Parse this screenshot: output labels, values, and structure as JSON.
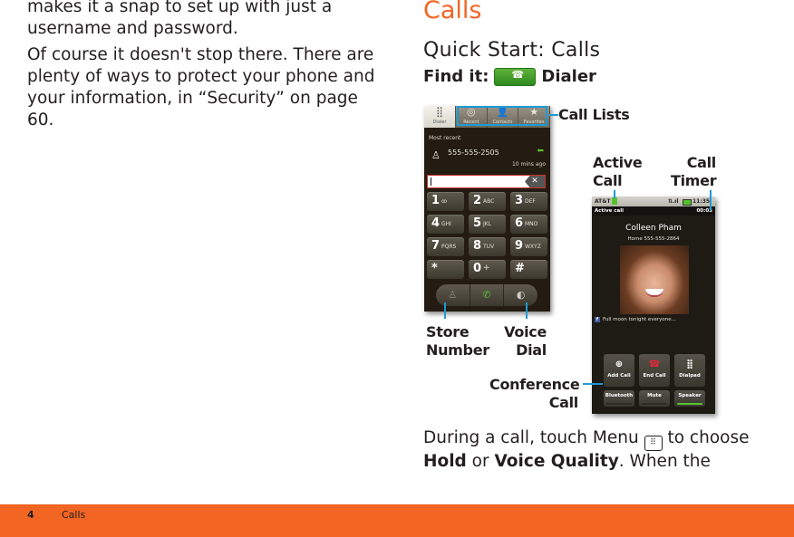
{
  "left_column": {
    "paragraph_1": "makes it a snap to set up with just a username and password.",
    "paragraph_2": "Of course it doesn't stop there. There are plenty of ways to protect your phone and your information, in “Security” on page 60."
  },
  "right_column": {
    "chapter_title": "Calls",
    "section_title": "Quick Start: Calls",
    "find_it_label": "Find it:",
    "find_it_target": "Dialer",
    "find_it_icon": "phone-handset-icon",
    "body": {
      "sentence_start": "During a call, touch Menu",
      "menu_icon": "menu-key-icon",
      "sentence_mid": "to choose",
      "option_1": "Hold",
      "connector": "or",
      "option_2": "Voice Quality",
      "sentence_end": ". When the"
    }
  },
  "dialer_screen": {
    "tabs": [
      {
        "label": "Dialer",
        "icon": "keypad-grid-icon",
        "active": true
      },
      {
        "label": "Recent",
        "icon": "recent-calls-icon",
        "active": false
      },
      {
        "label": "Contacts",
        "icon": "contact-icon",
        "active": false
      },
      {
        "label": "Favorites",
        "icon": "star-icon",
        "active": false
      }
    ],
    "section_label": "Most recent",
    "recent_call": {
      "number": "555-555-2505",
      "time": "10 mins ago",
      "direction_icon": "incoming-arrow-icon"
    },
    "input_value": "",
    "keys": [
      {
        "digit": "1",
        "letters": "ꝏ"
      },
      {
        "digit": "2",
        "letters": "ABC"
      },
      {
        "digit": "3",
        "letters": "DEF"
      },
      {
        "digit": "4",
        "letters": "GHI"
      },
      {
        "digit": "5",
        "letters": "JKL"
      },
      {
        "digit": "6",
        "letters": "MNO"
      },
      {
        "digit": "7",
        "letters": "PQRS"
      },
      {
        "digit": "8",
        "letters": "TUV"
      },
      {
        "digit": "9",
        "letters": "WXYZ"
      },
      {
        "digit": "*",
        "letters": ""
      },
      {
        "digit": "0",
        "letters": "+"
      },
      {
        "digit": "#",
        "letters": ""
      }
    ],
    "actions": [
      {
        "name": "store-number",
        "icon": "add-contact-icon"
      },
      {
        "name": "call",
        "icon": "phone-handset-icon"
      },
      {
        "name": "voice-dial",
        "icon": "voice-dial-icon"
      }
    ]
  },
  "call_screen": {
    "status_bar": {
      "carrier": "AT&T",
      "time": "11:35"
    },
    "header_label": "Active call",
    "timer": "00:03",
    "caller_name": "Colleen Pham",
    "caller_detail": "Home 555-555-2864",
    "social_status": "Full moon tonight everyone...",
    "buttons": [
      {
        "label": "Add Call",
        "icon": "add-circle-icon"
      },
      {
        "label": "End Call",
        "icon": "end-call-icon"
      },
      {
        "label": "Dialpad",
        "icon": "keypad-grid-icon"
      }
    ],
    "toggles": [
      {
        "label": "Bluetooth",
        "on": false
      },
      {
        "label": "Mute",
        "on": false
      },
      {
        "label": "Speaker",
        "on": true
      }
    ]
  },
  "callouts": {
    "call_lists": "Call Lists",
    "active_call_1": "Active",
    "active_call_2": "Call",
    "call_timer_1": "Call",
    "call_timer_2": "Timer",
    "store_number_1": "Store",
    "store_number_2": "Number",
    "voice_dial_1": "Voice",
    "voice_dial_2": "Dial",
    "conference_call_1": "Conference",
    "conference_call_2": "Call"
  },
  "footer": {
    "page_number": "4",
    "title": "Calls"
  },
  "colors": {
    "accent": "#f26522",
    "callout_line": "#1d9ad6",
    "call_green": "#55c12d",
    "end_red": "#e8263a"
  }
}
